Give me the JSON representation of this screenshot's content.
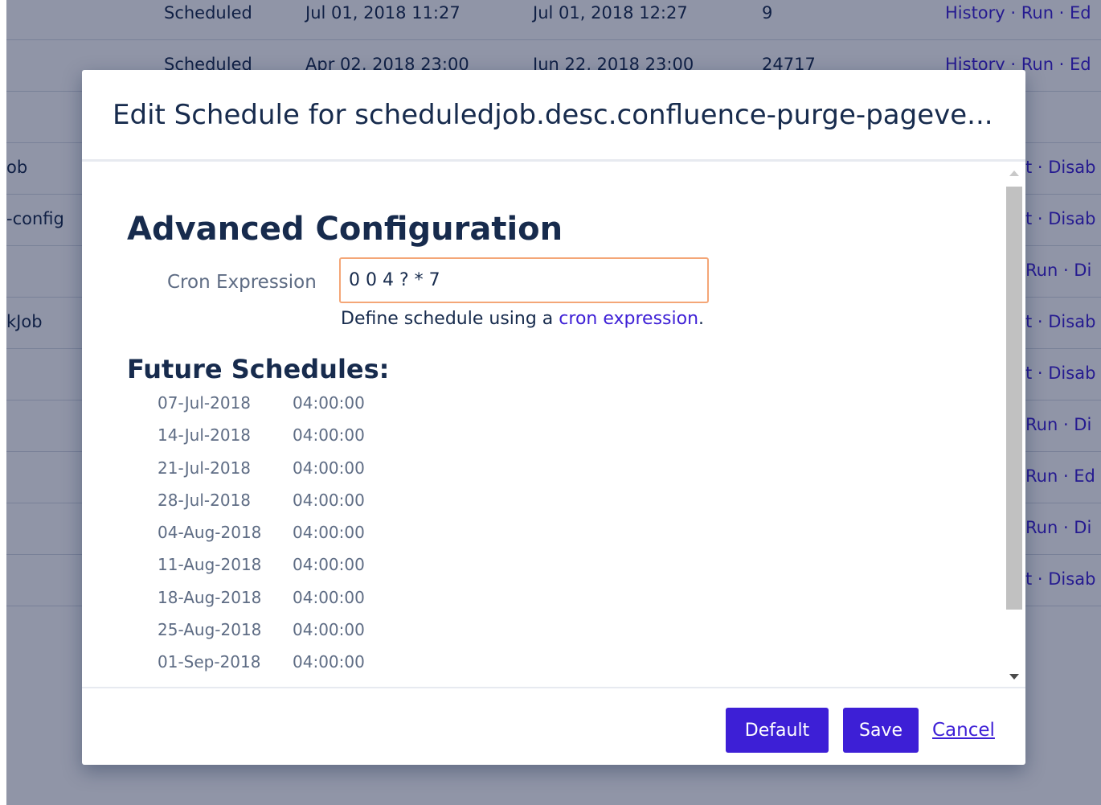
{
  "background": {
    "rows": [
      {
        "name": "",
        "status": "Scheduled",
        "last_run": "Jul 01, 2018 11:27",
        "next_run": "Jul 01, 2018 12:27",
        "avg": "9",
        "ops": "History · Run · Ed"
      },
      {
        "name": "",
        "status": "Scheduled",
        "last_run": "Apr 02, 2018 23:00",
        "next_run": "Jun 22, 2018 23:00",
        "avg": "24717",
        "ops": "History · Run · Ed"
      },
      {
        "name": "",
        "status": "",
        "last_run": "",
        "next_run": "",
        "avg": "",
        "ops": ""
      },
      {
        "name": "ob",
        "status": "",
        "last_run": "",
        "next_run": "",
        "avg": "",
        "ops": "t · Disab"
      },
      {
        "name": "-config",
        "status": "",
        "last_run": "",
        "next_run": "",
        "avg": "",
        "ops": "t · Disab"
      },
      {
        "name": "",
        "status": "",
        "last_run": "",
        "next_run": "",
        "avg": "",
        "ops": "Run · Di"
      },
      {
        "name": "kJob",
        "status": "",
        "last_run": "",
        "next_run": "",
        "avg": "",
        "ops": "t · Disab"
      },
      {
        "name": "",
        "status": "",
        "last_run": "",
        "next_run": "",
        "avg": "",
        "ops": "t · Disab"
      },
      {
        "name": "",
        "status": "",
        "last_run": "",
        "next_run": "",
        "avg": "",
        "ops": "Run · Di"
      },
      {
        "name": "",
        "status": "",
        "last_run": "",
        "next_run": "",
        "avg": "",
        "ops": "Run · Ed"
      },
      {
        "name": "",
        "status": "",
        "last_run": "",
        "next_run": "",
        "avg": "",
        "ops": "Run · Di"
      },
      {
        "name": "",
        "status": "",
        "last_run": "",
        "next_run": "",
        "avg": "",
        "ops": "t · Disab"
      }
    ]
  },
  "dialog": {
    "title": "Edit Schedule for scheduledjob.desc.confluence-purge-pageve...",
    "section_title": "Advanced Configuration",
    "cron": {
      "label": "Cron Expression",
      "value": "0 0 4 ? * 7",
      "help_prefix": "Define schedule using a ",
      "help_link": "cron expression",
      "help_suffix": "."
    },
    "future_title": "Future Schedules:",
    "schedules": [
      {
        "date": "07-Jul-2018",
        "time": "04:00:00"
      },
      {
        "date": "14-Jul-2018",
        "time": "04:00:00"
      },
      {
        "date": "21-Jul-2018",
        "time": "04:00:00"
      },
      {
        "date": "28-Jul-2018",
        "time": "04:00:00"
      },
      {
        "date": "04-Aug-2018",
        "time": "04:00:00"
      },
      {
        "date": "11-Aug-2018",
        "time": "04:00:00"
      },
      {
        "date": "18-Aug-2018",
        "time": "04:00:00"
      },
      {
        "date": "25-Aug-2018",
        "time": "04:00:00"
      },
      {
        "date": "01-Sep-2018",
        "time": "04:00:00"
      }
    ],
    "buttons": {
      "default": "Default",
      "save": "Save",
      "cancel": "Cancel"
    }
  },
  "colors": {
    "overlay": "#09143c",
    "primary": "#3d1fd6",
    "text": "#172b4d",
    "muted": "#5e6c84",
    "input_focus_border": "#f4a677"
  }
}
